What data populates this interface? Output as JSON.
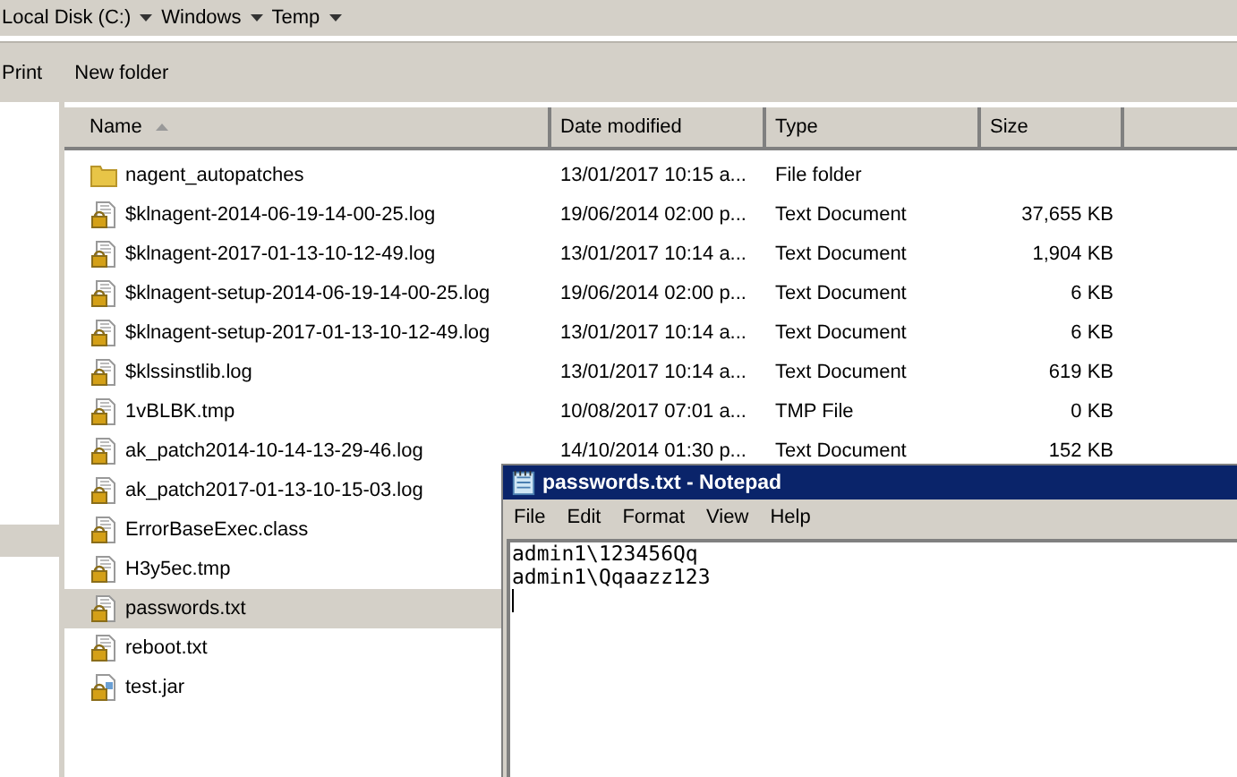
{
  "breadcrumb": [
    "Local Disk (C:)",
    "Windows",
    "Temp"
  ],
  "toolbar": [
    "Print",
    "New folder"
  ],
  "nav_pane": {
    "selected_band": true
  },
  "table": {
    "columns": [
      {
        "label": "Name",
        "sorted": true
      },
      {
        "label": "Date modified",
        "sorted": false
      },
      {
        "label": "Type",
        "sorted": false
      },
      {
        "label": "Size",
        "sorted": false
      }
    ],
    "rows": [
      {
        "kind": "folder",
        "name": "nagent_autopatches",
        "date": "13/01/2017 10:15 a...",
        "type": "File folder",
        "selected": false
      },
      {
        "kind": "locked",
        "name": "$klnagent-2014-06-19-14-00-25.log",
        "date": "19/06/2014 02:00 p...",
        "type": "Text Document",
        "size": "37,655 KB",
        "selected": false
      },
      {
        "kind": "locked",
        "name": "$klnagent-2017-01-13-10-12-49.log",
        "date": "13/01/2017 10:14 a...",
        "type": "Text Document",
        "size": "1,904 KB",
        "selected": false
      },
      {
        "kind": "locked",
        "name": "$klnagent-setup-2014-06-19-14-00-25.log",
        "date": "19/06/2014 02:00 p...",
        "type": "Text Document",
        "size": "6 KB",
        "selected": false
      },
      {
        "kind": "locked",
        "name": "$klnagent-setup-2017-01-13-10-12-49.log",
        "date": "13/01/2017 10:14 a...",
        "type": "Text Document",
        "size": "6 KB",
        "selected": false
      },
      {
        "kind": "locked",
        "name": "$klssinstlib.log",
        "date": "13/01/2017 10:14 a...",
        "type": "Text Document",
        "size": "619 KB",
        "selected": false
      },
      {
        "kind": "locked",
        "name": "1vBLBK.tmp",
        "date": "10/08/2017 07:01 a...",
        "type": "TMP File",
        "size": "0 KB",
        "selected": false
      },
      {
        "kind": "locked",
        "name": "ak_patch2014-10-14-13-29-46.log",
        "date": "14/10/2014 01:30 p...",
        "type": "Text Document",
        "size": "152 KB",
        "selected": false
      },
      {
        "kind": "locked",
        "name": "ak_patch2017-01-13-10-15-03.log",
        "selected": false
      },
      {
        "kind": "locked",
        "name": "ErrorBaseExec.class",
        "selected": false
      },
      {
        "kind": "locked",
        "name": "H3y5ec.tmp",
        "selected": false
      },
      {
        "kind": "locked",
        "name": "passwords.txt",
        "selected": true
      },
      {
        "kind": "locked",
        "name": "reboot.txt",
        "selected": false
      },
      {
        "kind": "jar",
        "name": "test.jar",
        "selected": false
      }
    ]
  },
  "notepad": {
    "title": "passwords.txt - Notepad",
    "menu": [
      "File",
      "Edit",
      "Format",
      "View",
      "Help"
    ],
    "lines": [
      "admin1\\123456Qq",
      "admin1\\Qqaazz123"
    ]
  }
}
